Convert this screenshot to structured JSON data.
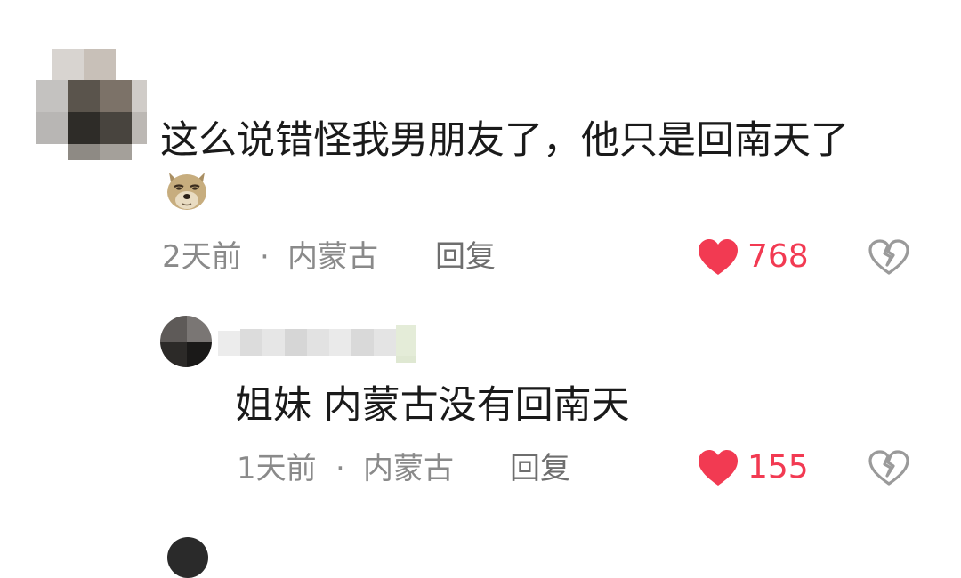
{
  "comments": [
    {
      "text": "这么说错怪我男朋友了，他只是回南天了",
      "emoji": "dog-face-emoji",
      "time": "2天前",
      "separator": "·",
      "location": "内蒙古",
      "reply_label": "回复",
      "likes": "768"
    }
  ],
  "replies": [
    {
      "text": "姐妹 内蒙古没有回南天",
      "time": "1天前",
      "separator": "·",
      "location": "内蒙古",
      "reply_label": "回复",
      "likes": "155"
    }
  ],
  "colors": {
    "like_red": "#f23a52",
    "meta_gray": "#8a8a8a",
    "text_dark": "#1a1a1a"
  }
}
